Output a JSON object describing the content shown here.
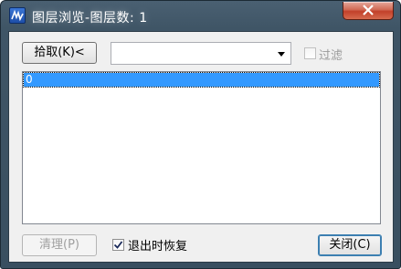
{
  "window": {
    "title": "图层浏览-图层数: 1",
    "app_icon": "app-icon",
    "close_icon": "close-icon"
  },
  "toolbar": {
    "pick_label": "拾取(K)<",
    "combo_value": "",
    "filter_label": "过滤",
    "filter_checked": false,
    "filter_enabled": false
  },
  "layer_list": {
    "items": [
      "0"
    ],
    "selected_index": 0
  },
  "footer": {
    "clean_label": "清理(P)",
    "clean_enabled": false,
    "restore_label": "退出时恢复",
    "restore_checked": true,
    "close_label": "关闭(C)"
  },
  "colors": {
    "selection": "#3399ff",
    "titlebar": "#3f5566",
    "close_button": "#c2402a"
  }
}
